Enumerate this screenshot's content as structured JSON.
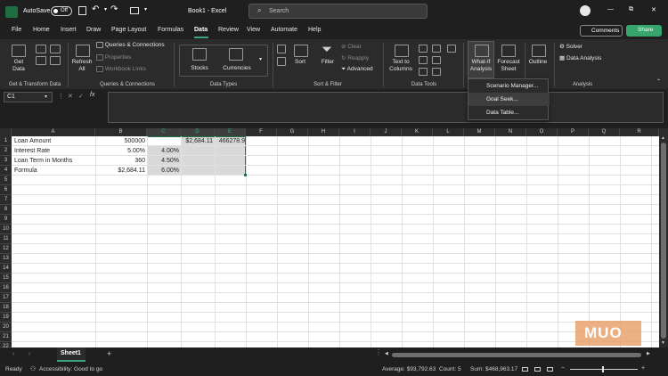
{
  "titlebar": {
    "autosave_label": "AutoSave",
    "autosave_state": "Off",
    "title": "Book1  -  Excel",
    "search_placeholder": "Search",
    "minimize": "—",
    "restore": "⧉",
    "close": "✕"
  },
  "tabs": [
    "File",
    "Home",
    "Insert",
    "Draw",
    "Page Layout",
    "Formulas",
    "Data",
    "Review",
    "View",
    "Automate",
    "Help"
  ],
  "active_tab": "Data",
  "actions": {
    "comments": "Comments",
    "share": "Share"
  },
  "ribbon": {
    "get_data": "Get",
    "get_data_2": "Data",
    "queries_connections": "Queries & Connections",
    "properties": "Properties",
    "workbook_links": "Workbook Links",
    "refresh": "Refresh",
    "refresh_2": "All",
    "stocks": "Stocks",
    "currencies": "Currencies",
    "sort": "Sort",
    "filter": "Filter",
    "clear": "Clear",
    "reapply": "Reapply",
    "advanced": "Advanced",
    "text_to_columns": "Text to",
    "text_to_columns_2": "Columns",
    "what_if": "What-If",
    "what_if_2": "Analysis",
    "forecast": "Forecast",
    "forecast_2": "Sheet",
    "outline": "Outline",
    "solver": "Solver",
    "data_analysis": "Data Analysis",
    "groups": {
      "get_transform": "Get & Transform Data",
      "queries": "Queries & Connections",
      "data_types": "Data Types",
      "sort_filter": "Sort & Filter",
      "data_tools": "Data Tools",
      "analysis": "Analysis"
    }
  },
  "whatif_menu": [
    "Scenario Manager...",
    "Goal Seek...",
    "Data Table..."
  ],
  "formula_bar": {
    "name_box": "C1",
    "fx": "fx",
    "value": ""
  },
  "columns": [
    "A",
    "B",
    "C",
    "D",
    "E",
    "F",
    "G",
    "H",
    "I",
    "J",
    "K",
    "L",
    "M",
    "N",
    "O",
    "P",
    "Q",
    "R"
  ],
  "rows": [
    "1",
    "2",
    "3",
    "4",
    "5",
    "6",
    "7",
    "8",
    "9",
    "10",
    "11",
    "12",
    "13",
    "14",
    "15",
    "16",
    "17",
    "18",
    "19",
    "20",
    "21",
    "22"
  ],
  "cells": {
    "A1": "Loan Amount",
    "B1": "500000",
    "D1": "$2,684.11",
    "E1": "466278.9",
    "A2": "Interest Rate",
    "B2": "5.00%",
    "C2": "4.00%",
    "A3": "Loan Term in Months",
    "B3": "360",
    "C3": "4.50%",
    "A4": "Formula",
    "B4": "$2,684.11",
    "C4": "6.00%"
  },
  "sheet_tab": "Sheet1",
  "add_sheet": "+",
  "watermark": "MUO",
  "status": {
    "ready": "Ready",
    "accessibility": "Accessibility: Good to go",
    "average": "Average: $93,792.63",
    "count": "Count: 5",
    "sum": "Sum: $468,963.17",
    "zoom_minus": "−",
    "zoom_plus": "+"
  },
  "colors": {
    "accent": "#3ca37a",
    "share": "#36a66c",
    "selection": "#d9d9d9"
  }
}
